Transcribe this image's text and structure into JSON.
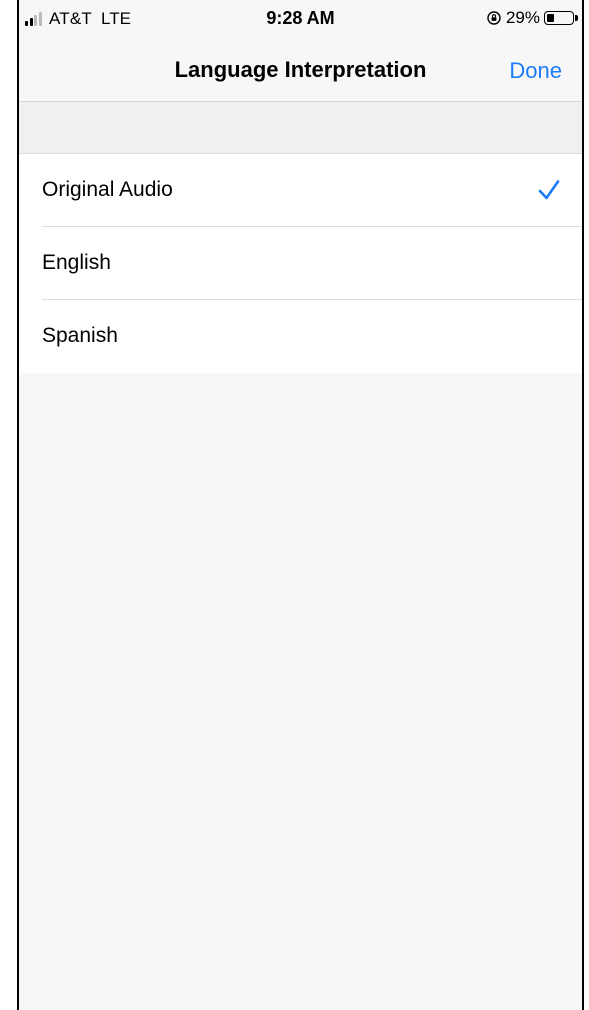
{
  "status_bar": {
    "carrier": "AT&T",
    "network": "LTE",
    "time": "9:28 AM",
    "battery_text": "29%",
    "battery_level": 0.29
  },
  "nav": {
    "title": "Language Interpretation",
    "done_label": "Done"
  },
  "options": [
    {
      "label": "Original Audio",
      "selected": true
    },
    {
      "label": "English",
      "selected": false
    },
    {
      "label": "Spanish",
      "selected": false
    }
  ],
  "colors": {
    "accent": "#1b7cf7"
  }
}
